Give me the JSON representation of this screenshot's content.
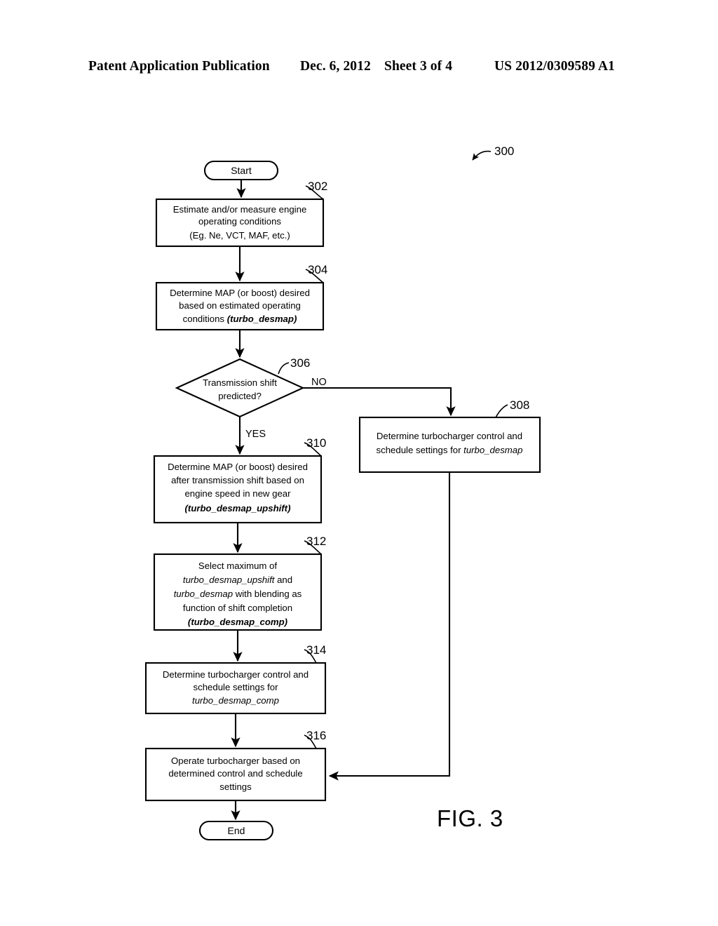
{
  "header": {
    "publication": "Patent Application Publication",
    "date": "Dec. 6, 2012",
    "sheet": "Sheet 3 of 4",
    "patent_number": "US 2012/0309589 A1"
  },
  "figure": {
    "label": "FIG. 3",
    "diagram_ref": "300",
    "start_label": "Start",
    "end_label": "End",
    "branch_yes": "YES",
    "branch_no": "NO",
    "nodes": [
      {
        "ref": "302",
        "lines": [
          "Estimate and/or measure engine",
          "operating conditions",
          "(Eg. Ne, VCT, MAF, etc.)"
        ]
      },
      {
        "ref": "304",
        "lines": [
          "Determine MAP (or boost) desired",
          "based on estimated operating",
          "conditions (turbo_desmap)"
        ]
      },
      {
        "ref": "306",
        "lines": [
          "Transmission shift",
          "predicted?"
        ]
      },
      {
        "ref": "308",
        "lines": [
          "Determine turbocharger control and",
          "schedule settings for turbo_desmap"
        ]
      },
      {
        "ref": "310",
        "lines": [
          "Determine MAP (or boost) desired",
          "after transmission shift based on",
          "engine speed in new gear",
          "(turbo_desmap_upshift)"
        ]
      },
      {
        "ref": "312",
        "lines": [
          "Select maximum of",
          "turbo_desmap_upshift and",
          "turbo_desmap with blending as",
          "function of shift completion",
          "(turbo_desmap_comp)"
        ]
      },
      {
        "ref": "314",
        "lines": [
          "Determine turbocharger control and",
          "schedule settings for",
          "turbo_desmap_comp"
        ]
      },
      {
        "ref": "316",
        "lines": [
          "Operate turbocharger based on",
          "determined control and schedule",
          "settings"
        ]
      }
    ],
    "text_fragments": {
      "n302_l1": "Estimate and/or measure engine",
      "n302_l2": "operating conditions",
      "n302_l3": "(Eg. Ne, VCT, MAF, etc.)",
      "n304_l1": "Determine MAP (or boost) desired",
      "n304_l2": "based on estimated operating",
      "n304_l3a": "conditions ",
      "n304_l3b": "(turbo_desmap)",
      "n306_l1": "Transmission shift",
      "n306_l2": "predicted?",
      "n308_l1": "Determine turbocharger control and",
      "n308_l2a": "schedule settings for ",
      "n308_l2b": "turbo_desmap",
      "n310_l1": "Determine MAP (or boost) desired",
      "n310_l2": "after transmission shift based on",
      "n310_l3": "engine speed in new gear",
      "n310_l4": "(turbo_desmap_upshift)",
      "n312_l1": "Select maximum of",
      "n312_l2a": "turbo_desmap_upshift",
      "n312_l2b": " and",
      "n312_l3a": "turbo_desmap",
      "n312_l3b": " with blending as",
      "n312_l4": "function of shift completion",
      "n312_l5": "(turbo_desmap_comp)",
      "n314_l1": "Determine turbocharger control and",
      "n314_l2": "schedule settings for",
      "n314_l3": "turbo_desmap_comp",
      "n316_l1": "Operate turbocharger based on",
      "n316_l2": "determined control and schedule",
      "n316_l3": "settings"
    },
    "refs": {
      "r300": "300",
      "r302": "302",
      "r304": "304",
      "r306": "306",
      "r308": "308",
      "r310": "310",
      "r312": "312",
      "r314": "314",
      "r316": "316"
    }
  },
  "colors": {
    "ink": "#000000",
    "paper": "#ffffff"
  }
}
